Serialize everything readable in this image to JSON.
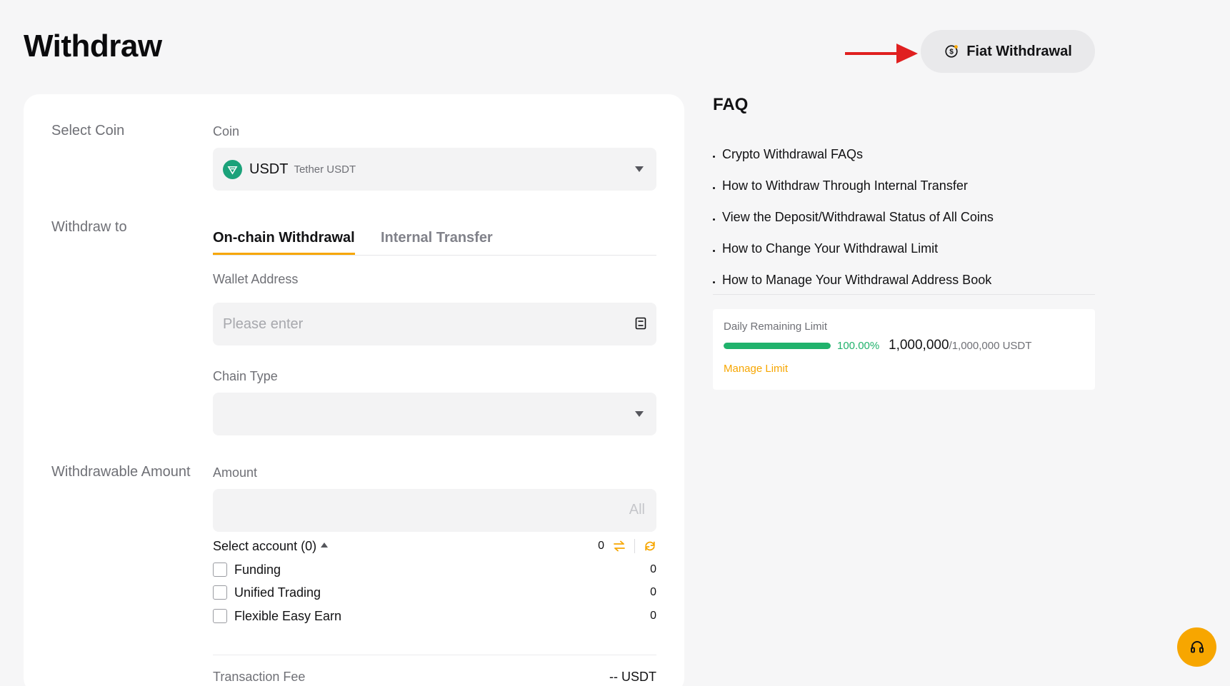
{
  "page": {
    "title": "Withdraw"
  },
  "header": {
    "fiat_button_label": "Fiat Withdrawal",
    "fiat_icon": "dollar-cycle-icon",
    "arrow_color": "#e02020"
  },
  "form": {
    "select_coin_label": "Select Coin",
    "coin_field_label": "Coin",
    "coin": {
      "symbol": "USDT",
      "name": "Tether USDT",
      "icon": "tether-icon",
      "icon_color": "#1ba27a"
    },
    "withdraw_to_label": "Withdraw to",
    "tabs": [
      {
        "label": "On-chain Withdrawal",
        "active": true
      },
      {
        "label": "Internal Transfer",
        "active": false
      }
    ],
    "wallet_address_label": "Wallet Address",
    "wallet_address_placeholder": "Please enter",
    "chain_type_label": "Chain Type",
    "chain_type_value": "",
    "withdrawable_amount_label": "Withdrawable Amount",
    "amount_label": "Amount",
    "amount_all": "All",
    "select_account_label": "Select account (0)",
    "select_account_total": "0",
    "accounts": [
      {
        "label": "Funding",
        "value": "0",
        "checked": false
      },
      {
        "label": "Unified Trading",
        "value": "0",
        "checked": false
      },
      {
        "label": "Flexible Easy Earn",
        "value": "0",
        "checked": false
      }
    ],
    "transaction_fee_label": "Transaction Fee",
    "transaction_fee_value": "-- USDT"
  },
  "faq": {
    "title": "FAQ",
    "items": [
      "Crypto Withdrawal FAQs",
      "How to Withdraw Through Internal Transfer",
      "View the Deposit/Withdrawal Status of All Coins",
      "How to Change Your Withdrawal Limit",
      "How to Manage Your Withdrawal Address Book"
    ]
  },
  "limit": {
    "title": "Daily Remaining Limit",
    "percent_text": "100.00%",
    "percent_value": 1.0,
    "remaining": "1,000,000",
    "total": "/1,000,000 USDT",
    "manage_label": "Manage Limit",
    "bar_color": "#20b26c"
  },
  "colors": {
    "accent": "#f7a600",
    "success": "#20b26c",
    "background": "#f6f6f7"
  }
}
